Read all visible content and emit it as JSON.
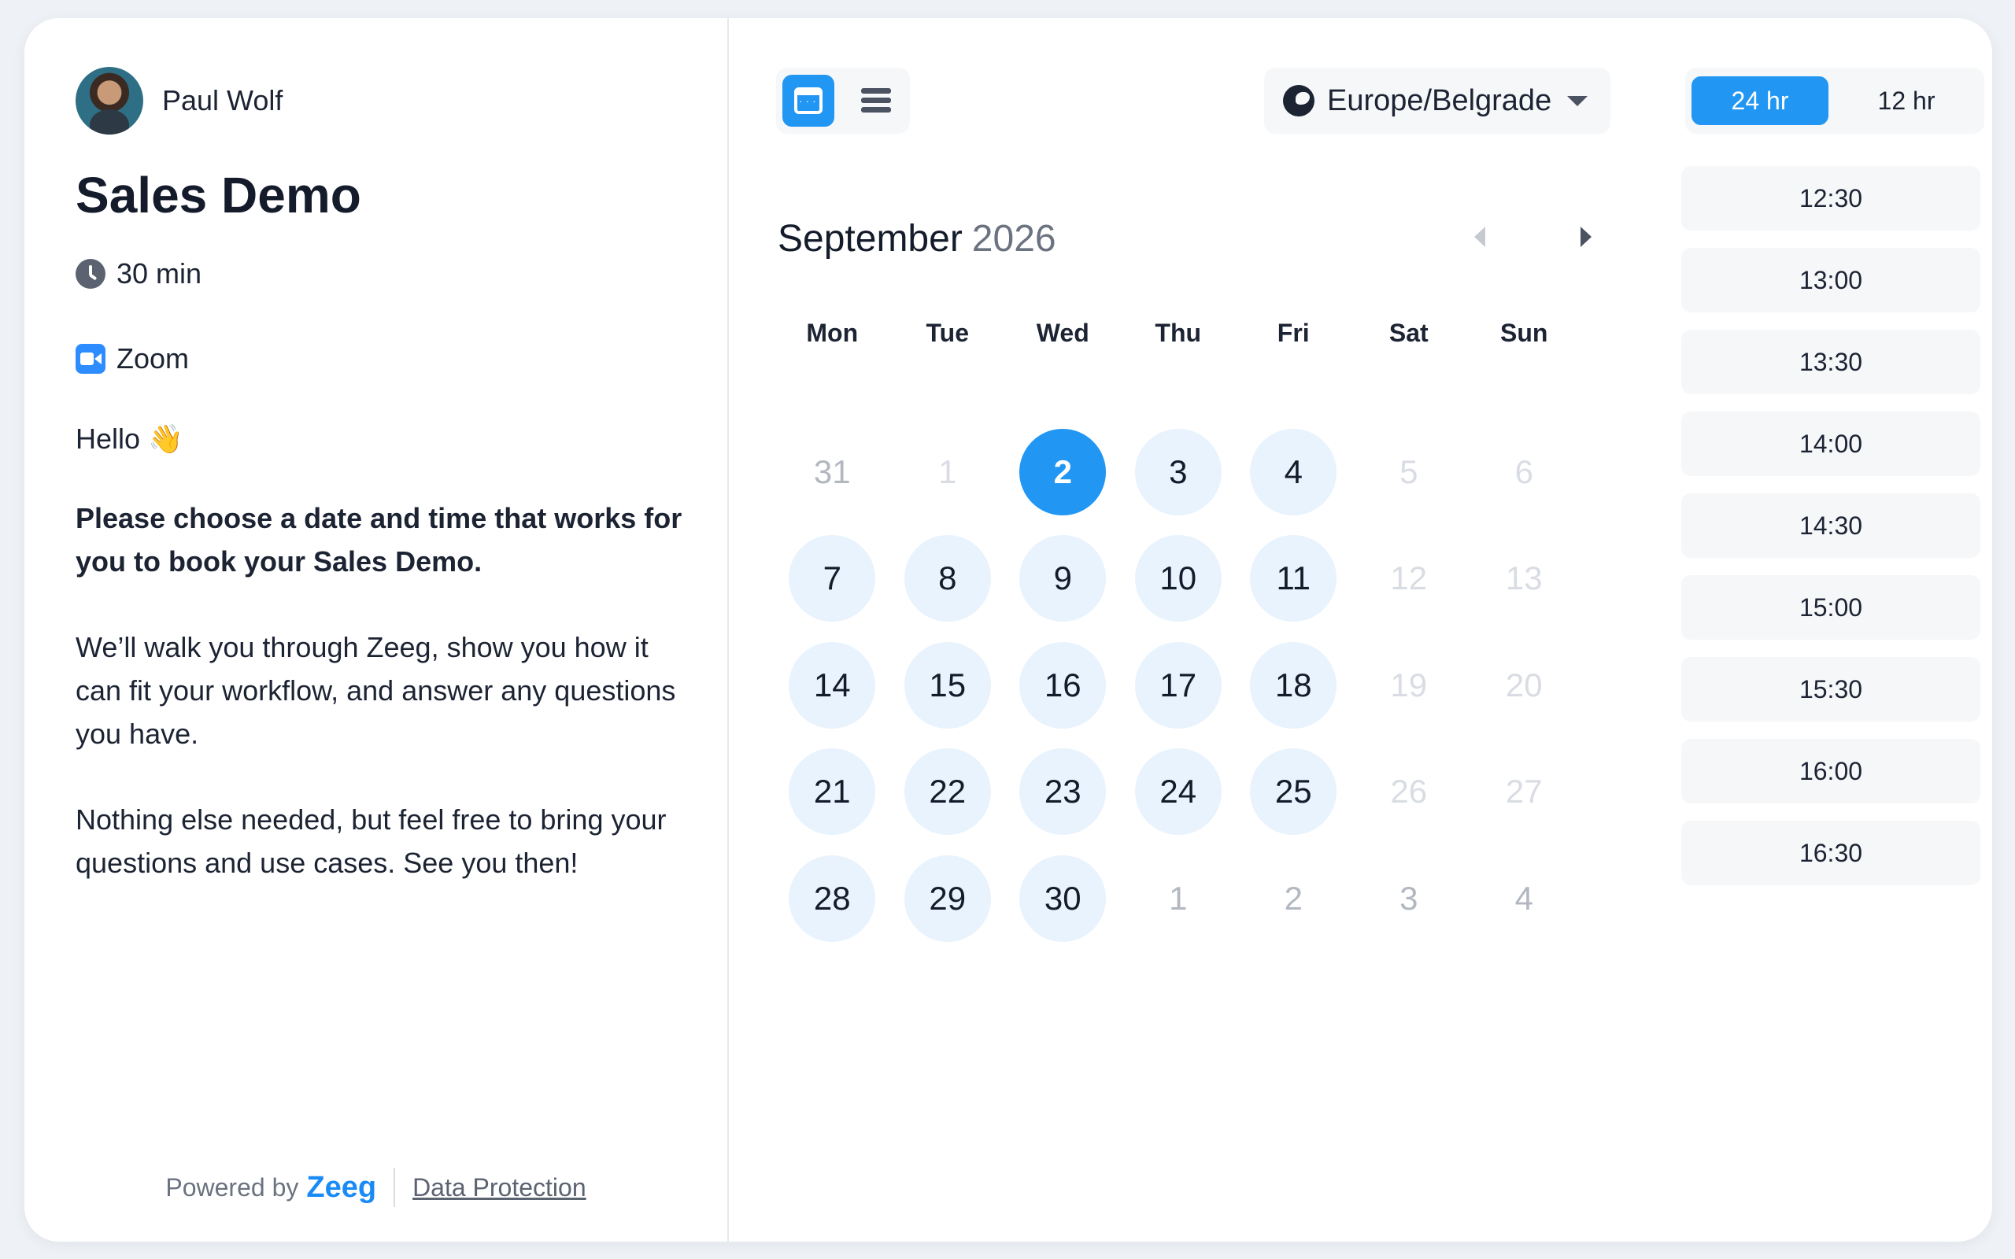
{
  "host": {
    "name": "Paul Wolf"
  },
  "event": {
    "title": "Sales Demo",
    "duration": "30 min",
    "location": "Zoom",
    "greeting": "Hello 👋",
    "intro": "Please choose a date and time that works for you to book your Sales Demo.",
    "paragraph1": "We’ll walk you through Zeeg, show you how it can fit your workflow, and answer any questions you have.",
    "paragraph2": "Nothing else needed, but feel free to bring your questions and use cases. See you then!"
  },
  "footer": {
    "powered_by": "Powered by",
    "brand": "Zeeg",
    "data_protection": "Data Protection"
  },
  "timezone": "Europe/Belgrade",
  "calendar": {
    "month": "September",
    "year": "2026",
    "weekdays": [
      "Mon",
      "Tue",
      "Wed",
      "Thu",
      "Fri",
      "Sat",
      "Sun"
    ],
    "days": [
      {
        "label": "31",
        "state": "other"
      },
      {
        "label": "1",
        "state": "disabled"
      },
      {
        "label": "2",
        "state": "selected"
      },
      {
        "label": "3",
        "state": "available"
      },
      {
        "label": "4",
        "state": "available"
      },
      {
        "label": "5",
        "state": "disabled"
      },
      {
        "label": "6",
        "state": "disabled"
      },
      {
        "label": "7",
        "state": "available"
      },
      {
        "label": "8",
        "state": "available"
      },
      {
        "label": "9",
        "state": "available"
      },
      {
        "label": "10",
        "state": "available"
      },
      {
        "label": "11",
        "state": "available"
      },
      {
        "label": "12",
        "state": "disabled"
      },
      {
        "label": "13",
        "state": "disabled"
      },
      {
        "label": "14",
        "state": "available"
      },
      {
        "label": "15",
        "state": "available"
      },
      {
        "label": "16",
        "state": "available"
      },
      {
        "label": "17",
        "state": "available"
      },
      {
        "label": "18",
        "state": "available"
      },
      {
        "label": "19",
        "state": "disabled"
      },
      {
        "label": "20",
        "state": "disabled"
      },
      {
        "label": "21",
        "state": "available"
      },
      {
        "label": "22",
        "state": "available"
      },
      {
        "label": "23",
        "state": "available"
      },
      {
        "label": "24",
        "state": "available"
      },
      {
        "label": "25",
        "state": "available"
      },
      {
        "label": "26",
        "state": "disabled"
      },
      {
        "label": "27",
        "state": "disabled"
      },
      {
        "label": "28",
        "state": "available"
      },
      {
        "label": "29",
        "state": "available"
      },
      {
        "label": "30",
        "state": "available"
      },
      {
        "label": "1",
        "state": "other"
      },
      {
        "label": "2",
        "state": "other"
      },
      {
        "label": "3",
        "state": "other"
      },
      {
        "label": "4",
        "state": "other"
      }
    ]
  },
  "time_format": {
    "options": [
      "24 hr",
      "12 hr"
    ],
    "selected": "24 hr"
  },
  "time_slots": [
    "12:30",
    "13:00",
    "13:30",
    "14:00",
    "14:30",
    "15:00",
    "15:30",
    "16:00",
    "16:30"
  ],
  "colors": {
    "accent": "#2196f3",
    "available_day_bg": "#e8f3fd",
    "brand": "#1a8bf5"
  }
}
